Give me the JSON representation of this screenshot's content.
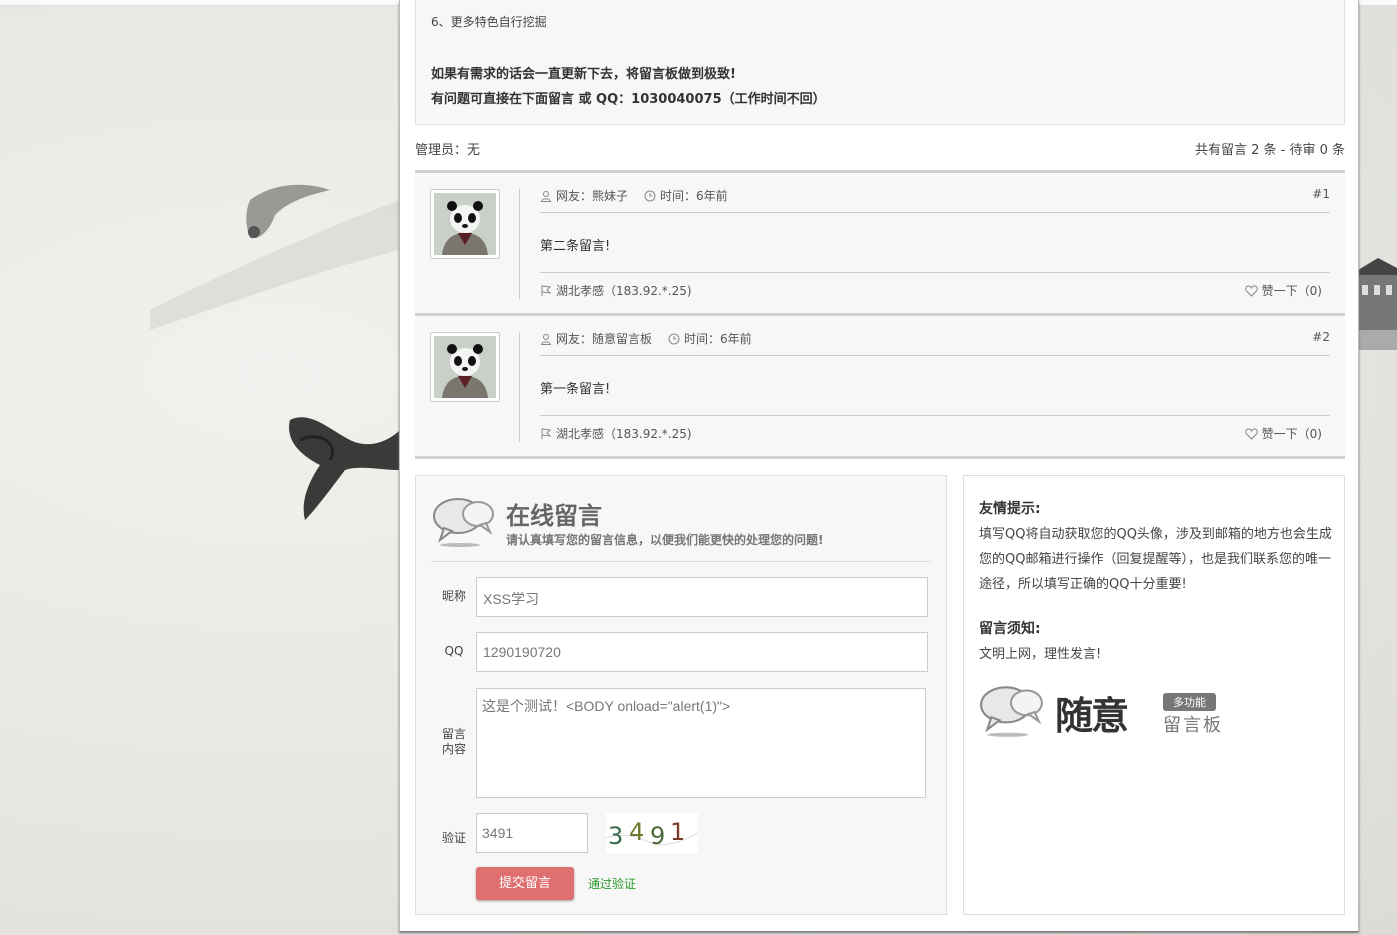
{
  "intro": {
    "line1": "6、更多特色自行挖掘",
    "line2": "如果有需求的话会一直更新下去，将留言板做到极致!",
    "line3": "有问题可直接在下面留言 或 QQ：1030040075（工作时间不回）"
  },
  "meta": {
    "admin": "管理员：无",
    "summary": "共有留言 2 条 - 待审 0 条"
  },
  "messages": [
    {
      "user": "网友：熊妹子",
      "time": "时间：6年前",
      "num": "#1",
      "content": "第二条留言!",
      "location": "湖北孝感（183.92.*.25)",
      "like": "赞一下（0)"
    },
    {
      "user": "网友：随意留言板",
      "time": "时间：6年前",
      "num": "#2",
      "content": "第一条留言!",
      "location": "湖北孝感（183.92.*.25)",
      "like": "赞一下（0)"
    }
  ],
  "form": {
    "title": "在线留言",
    "subtitle": "请认真填写您的留言信息，以便我们能更快的处理您的问题!",
    "nickname_label": "昵称",
    "nickname_value": "XSS学习",
    "qq_label": "QQ",
    "qq_value": "1290190720",
    "content_label_1": "留言",
    "content_label_2": "内容",
    "content_value": "这是个测试！<BODY onload=\"alert(1)\">",
    "verify_label": "验证",
    "verify_value": "3491",
    "captcha_text": "3491",
    "submit_label": "提交留言",
    "verify_status": "通过验证"
  },
  "side": {
    "tip_title": "友情提示:",
    "tip_text": "填写QQ将自动获取您的QQ头像，涉及到邮箱的地方也会生成您的QQ邮箱进行操作（回复提醒等），也是我们联系您的唯一途径，所以填写正确的QQ十分重要!",
    "notice_title": "留言须知:",
    "notice_text": "文明上网，理性发言!",
    "logo_main": "随意",
    "logo_badge": "多功能",
    "logo_sub": "留言板"
  },
  "colors": {
    "submit": "#e07070",
    "verified": "#2a9a2a",
    "panel": "#f7f7f7"
  }
}
